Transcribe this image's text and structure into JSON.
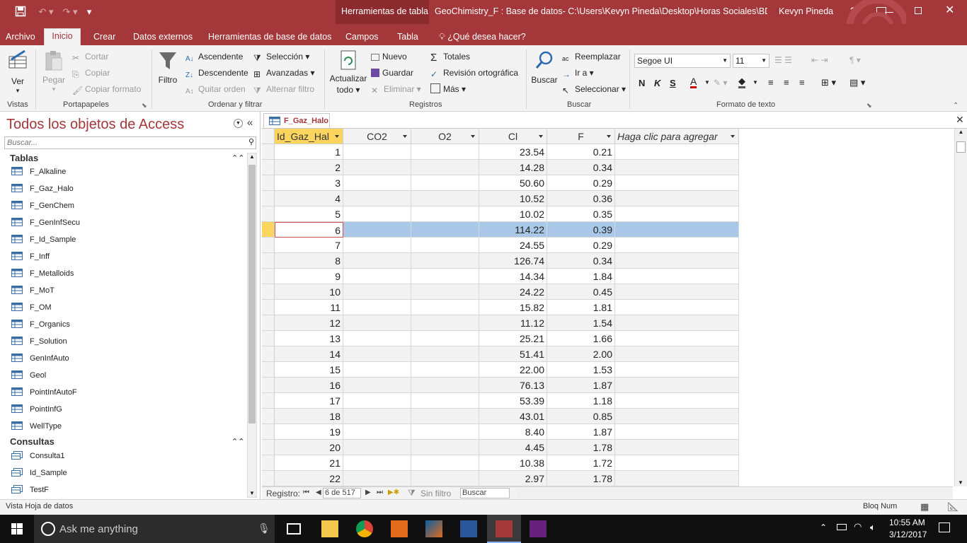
{
  "window": {
    "context_tab_group": "Herramientas de tabla",
    "title": "GeoChimistry_F : Base de datos- C:\\Users\\Kevyn Pineda\\Desktop\\Horas Sociales\\BDD_...",
    "user": "Kevyn Pineda",
    "help": "?",
    "accent": "#a4373a"
  },
  "tabs": [
    "Archivo",
    "Inicio",
    "Crear",
    "Datos externos",
    "Herramientas de base de datos",
    "Campos",
    "Tabla"
  ],
  "tell_me": "¿Qué desea hacer?",
  "ribbon": {
    "vistas": {
      "ver": "Ver",
      "group": "Vistas"
    },
    "portapapeles": {
      "pegar": "Pegar",
      "cortar": "Cortar",
      "copiar": "Copiar",
      "copiar_formato": "Copiar formato",
      "group": "Portapapeles"
    },
    "ordenar": {
      "filtro": "Filtro",
      "ascendente": "Ascendente",
      "descendente": "Descendente",
      "quitar_orden": "Quitar orden",
      "seleccion": "Selección",
      "avanzadas": "Avanzadas",
      "alternar_filtro": "Alternar filtro",
      "group": "Ordenar y filtrar"
    },
    "registros": {
      "actualizar": "Actualizar",
      "todo": "todo",
      "nuevo": "Nuevo",
      "guardar": "Guardar",
      "eliminar": "Eliminar",
      "totales": "Totales",
      "revision": "Revisión ortográfica",
      "mas": "Más",
      "group": "Registros"
    },
    "buscar": {
      "buscar": "Buscar",
      "reemplazar": "Reemplazar",
      "ir_a": "Ir a",
      "seleccionar": "Seleccionar",
      "group": "Buscar"
    },
    "formato": {
      "font": "Segoe UI",
      "size": "11",
      "bold": "N",
      "italic": "K",
      "underline": "S",
      "group": "Formato de texto"
    }
  },
  "nav": {
    "title": "Todos los objetos de Access",
    "search_placeholder": "Buscar...",
    "section_tables": "Tablas",
    "tables": [
      "F_Alkaline",
      "F_Gaz_Halo",
      "F_GenChem",
      "F_GenInfSecu",
      "F_Id_Sample",
      "F_Inff",
      "F_Metalloids",
      "F_MoT",
      "F_OM",
      "F_Organics",
      "F_Solution",
      "GenInfAuto",
      "Geol",
      "PointInfAutoF",
      "PointInfG",
      "WellType"
    ],
    "section_queries": "Consultas",
    "queries": [
      "Consulta1",
      "Id_Sample",
      "TestF"
    ]
  },
  "document": {
    "tab": "F_Gaz_Halo",
    "columns": [
      "Id_Gaz_Hal",
      "CO2",
      "O2",
      "Cl",
      "F",
      "Haga clic para agregar"
    ],
    "rows": [
      [
        "1",
        "",
        "",
        "23.54",
        "0.21"
      ],
      [
        "2",
        "",
        "",
        "14.28",
        "0.34"
      ],
      [
        "3",
        "",
        "",
        "50.60",
        "0.29"
      ],
      [
        "4",
        "",
        "",
        "10.52",
        "0.36"
      ],
      [
        "5",
        "",
        "",
        "10.02",
        "0.35"
      ],
      [
        "6",
        "",
        "",
        "114.22",
        "0.39"
      ],
      [
        "7",
        "",
        "",
        "24.55",
        "0.29"
      ],
      [
        "8",
        "",
        "",
        "126.74",
        "0.34"
      ],
      [
        "9",
        "",
        "",
        "14.34",
        "1.84"
      ],
      [
        "10",
        "",
        "",
        "24.22",
        "0.45"
      ],
      [
        "11",
        "",
        "",
        "15.82",
        "1.81"
      ],
      [
        "12",
        "",
        "",
        "11.12",
        "1.54"
      ],
      [
        "13",
        "",
        "",
        "25.21",
        "1.66"
      ],
      [
        "14",
        "",
        "",
        "51.41",
        "2.00"
      ],
      [
        "15",
        "",
        "",
        "22.00",
        "1.53"
      ],
      [
        "16",
        "",
        "",
        "76.13",
        "1.87"
      ],
      [
        "17",
        "",
        "",
        "53.39",
        "1.18"
      ],
      [
        "18",
        "",
        "",
        "43.01",
        "0.85"
      ],
      [
        "19",
        "",
        "",
        "8.40",
        "1.87"
      ],
      [
        "20",
        "",
        "",
        "4.45",
        "1.78"
      ],
      [
        "21",
        "",
        "",
        "10.38",
        "1.72"
      ],
      [
        "22",
        "",
        "",
        "2.97",
        "1.78"
      ]
    ],
    "selected_row": 5,
    "record_label": "Registro:",
    "record_value": "6 de 517",
    "filter_label": "Sin filtro",
    "search_value": "Buscar"
  },
  "status": {
    "left": "Vista Hoja de datos",
    "right": "Bloq Num"
  },
  "taskbar": {
    "search_placeholder": "Ask me anything",
    "time": "10:55 AM",
    "date": "3/12/2017"
  }
}
